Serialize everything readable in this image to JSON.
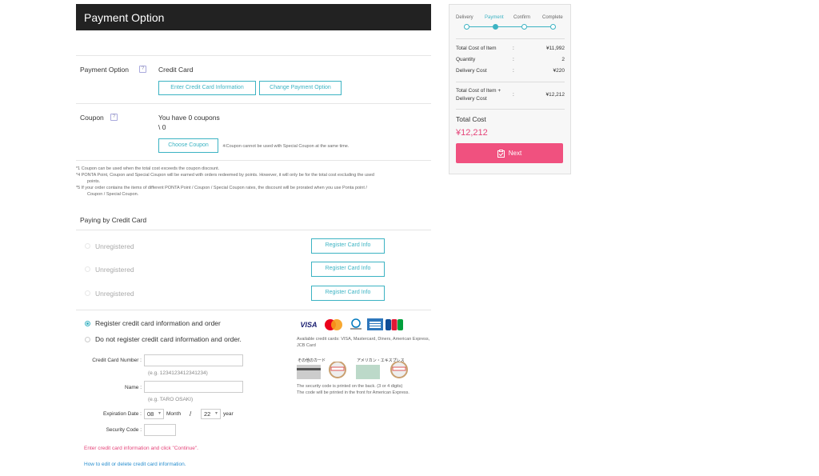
{
  "header": {
    "title": "Payment Option"
  },
  "payment_option": {
    "label": "Payment Option",
    "help": "?",
    "value": "Credit Card",
    "enter_button": "Enter Credit Card Information",
    "change_button": "Change Payment Option"
  },
  "coupon": {
    "label": "Coupon",
    "help": "?",
    "count_text": "You have 0 coupons",
    "amount": "\\ 0",
    "choose_button": "Choose Coupon",
    "note": "※Coupon cannot be used with Special Coupon at the same time."
  },
  "footnotes": [
    "*1 Coupon can be used when the total cost exceeds the coupon discount.",
    "*4 PONTA Point, Coupon and Special Coupon will be earned with orders redeemed by points. However, it will only be for the total cost excluding the used",
    "points.",
    "*5 If your order contains the items of different PONTA Point / Coupon / Special Coupon rates, the discount will be prorated when you use Ponta point /",
    "Coupon / Special Coupon."
  ],
  "credit_card": {
    "section_title": "Paying by Credit Card",
    "slots": [
      {
        "label": "Unregistered",
        "button": "Register Card Info"
      },
      {
        "label": "Unregistered",
        "button": "Register Card Info"
      },
      {
        "label": "Unregistered",
        "button": "Register Card Info"
      }
    ],
    "option_register": "Register credit card information and order",
    "option_no_register": "Do not register credit card information and order.",
    "number_label": "Credit Card Number :",
    "number_hint": "(e.g. 1234123412341234)",
    "name_label": "Name :",
    "name_hint": "(e.g. TARO OSAKI)",
    "expiry_label": "Expiration Date :",
    "expiry_month": "08",
    "month_label": "Month",
    "slash": "/",
    "expiry_year": "22",
    "year_label": "year",
    "security_label": "Security Code :",
    "instruction": "Enter credit card information and click \"Continue\".",
    "edit_link": "How to edit or delete credit card information.",
    "available_cards": "Available credit cards: VISA, Mastercard, Diners, American Express, JCB Card",
    "other_card_caption": "その他のカード",
    "amex_caption": "アメリカン・エキスプレス",
    "security_note_1": "The security code is printed on the back. (3 or 4 digits)",
    "security_note_2": "The code will be printed in the front for American Express.",
    "logos": [
      "VISA",
      "MasterCard",
      "Diners Club International",
      "AMEX",
      "JCB"
    ]
  },
  "sidebar": {
    "steps": [
      "Delivery",
      "Payment",
      "Confirm",
      "Complete"
    ],
    "active_step": 1,
    "rows": [
      {
        "label": "Total Cost of Item",
        "colon": ":",
        "value": "¥11,992"
      },
      {
        "label": "Quantity",
        "colon": ":",
        "value": "2"
      },
      {
        "label": "Delivery Cost",
        "colon": ":",
        "value": "¥220"
      }
    ],
    "combined_label_1": "Total Cost of Item +",
    "combined_label_2": "Delivery Cost",
    "combined_colon": ":",
    "combined_value": "¥12,212",
    "total_label": "Total Cost",
    "total_value": "¥12,212",
    "next_button": "Next",
    "accent": "#3cb3c3",
    "button_color": "#f0517f"
  }
}
